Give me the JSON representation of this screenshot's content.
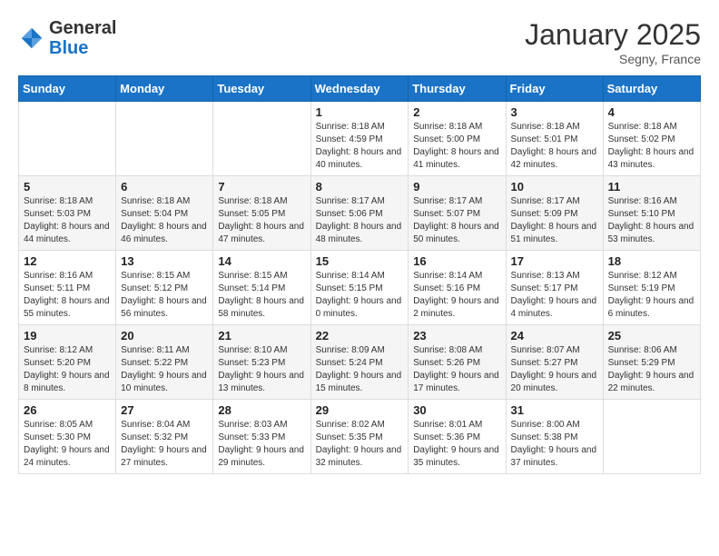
{
  "header": {
    "logo_line1": "General",
    "logo_line2": "Blue",
    "month_year": "January 2025",
    "location": "Segny, France"
  },
  "weekdays": [
    "Sunday",
    "Monday",
    "Tuesday",
    "Wednesday",
    "Thursday",
    "Friday",
    "Saturday"
  ],
  "weeks": [
    [
      {
        "day": "",
        "sunrise": "",
        "sunset": "",
        "daylight": ""
      },
      {
        "day": "",
        "sunrise": "",
        "sunset": "",
        "daylight": ""
      },
      {
        "day": "",
        "sunrise": "",
        "sunset": "",
        "daylight": ""
      },
      {
        "day": "1",
        "sunrise": "Sunrise: 8:18 AM",
        "sunset": "Sunset: 4:59 PM",
        "daylight": "Daylight: 8 hours and 40 minutes."
      },
      {
        "day": "2",
        "sunrise": "Sunrise: 8:18 AM",
        "sunset": "Sunset: 5:00 PM",
        "daylight": "Daylight: 8 hours and 41 minutes."
      },
      {
        "day": "3",
        "sunrise": "Sunrise: 8:18 AM",
        "sunset": "Sunset: 5:01 PM",
        "daylight": "Daylight: 8 hours and 42 minutes."
      },
      {
        "day": "4",
        "sunrise": "Sunrise: 8:18 AM",
        "sunset": "Sunset: 5:02 PM",
        "daylight": "Daylight: 8 hours and 43 minutes."
      }
    ],
    [
      {
        "day": "5",
        "sunrise": "Sunrise: 8:18 AM",
        "sunset": "Sunset: 5:03 PM",
        "daylight": "Daylight: 8 hours and 44 minutes."
      },
      {
        "day": "6",
        "sunrise": "Sunrise: 8:18 AM",
        "sunset": "Sunset: 5:04 PM",
        "daylight": "Daylight: 8 hours and 46 minutes."
      },
      {
        "day": "7",
        "sunrise": "Sunrise: 8:18 AM",
        "sunset": "Sunset: 5:05 PM",
        "daylight": "Daylight: 8 hours and 47 minutes."
      },
      {
        "day": "8",
        "sunrise": "Sunrise: 8:17 AM",
        "sunset": "Sunset: 5:06 PM",
        "daylight": "Daylight: 8 hours and 48 minutes."
      },
      {
        "day": "9",
        "sunrise": "Sunrise: 8:17 AM",
        "sunset": "Sunset: 5:07 PM",
        "daylight": "Daylight: 8 hours and 50 minutes."
      },
      {
        "day": "10",
        "sunrise": "Sunrise: 8:17 AM",
        "sunset": "Sunset: 5:09 PM",
        "daylight": "Daylight: 8 hours and 51 minutes."
      },
      {
        "day": "11",
        "sunrise": "Sunrise: 8:16 AM",
        "sunset": "Sunset: 5:10 PM",
        "daylight": "Daylight: 8 hours and 53 minutes."
      }
    ],
    [
      {
        "day": "12",
        "sunrise": "Sunrise: 8:16 AM",
        "sunset": "Sunset: 5:11 PM",
        "daylight": "Daylight: 8 hours and 55 minutes."
      },
      {
        "day": "13",
        "sunrise": "Sunrise: 8:15 AM",
        "sunset": "Sunset: 5:12 PM",
        "daylight": "Daylight: 8 hours and 56 minutes."
      },
      {
        "day": "14",
        "sunrise": "Sunrise: 8:15 AM",
        "sunset": "Sunset: 5:14 PM",
        "daylight": "Daylight: 8 hours and 58 minutes."
      },
      {
        "day": "15",
        "sunrise": "Sunrise: 8:14 AM",
        "sunset": "Sunset: 5:15 PM",
        "daylight": "Daylight: 9 hours and 0 minutes."
      },
      {
        "day": "16",
        "sunrise": "Sunrise: 8:14 AM",
        "sunset": "Sunset: 5:16 PM",
        "daylight": "Daylight: 9 hours and 2 minutes."
      },
      {
        "day": "17",
        "sunrise": "Sunrise: 8:13 AM",
        "sunset": "Sunset: 5:17 PM",
        "daylight": "Daylight: 9 hours and 4 minutes."
      },
      {
        "day": "18",
        "sunrise": "Sunrise: 8:12 AM",
        "sunset": "Sunset: 5:19 PM",
        "daylight": "Daylight: 9 hours and 6 minutes."
      }
    ],
    [
      {
        "day": "19",
        "sunrise": "Sunrise: 8:12 AM",
        "sunset": "Sunset: 5:20 PM",
        "daylight": "Daylight: 9 hours and 8 minutes."
      },
      {
        "day": "20",
        "sunrise": "Sunrise: 8:11 AM",
        "sunset": "Sunset: 5:22 PM",
        "daylight": "Daylight: 9 hours and 10 minutes."
      },
      {
        "day": "21",
        "sunrise": "Sunrise: 8:10 AM",
        "sunset": "Sunset: 5:23 PM",
        "daylight": "Daylight: 9 hours and 13 minutes."
      },
      {
        "day": "22",
        "sunrise": "Sunrise: 8:09 AM",
        "sunset": "Sunset: 5:24 PM",
        "daylight": "Daylight: 9 hours and 15 minutes."
      },
      {
        "day": "23",
        "sunrise": "Sunrise: 8:08 AM",
        "sunset": "Sunset: 5:26 PM",
        "daylight": "Daylight: 9 hours and 17 minutes."
      },
      {
        "day": "24",
        "sunrise": "Sunrise: 8:07 AM",
        "sunset": "Sunset: 5:27 PM",
        "daylight": "Daylight: 9 hours and 20 minutes."
      },
      {
        "day": "25",
        "sunrise": "Sunrise: 8:06 AM",
        "sunset": "Sunset: 5:29 PM",
        "daylight": "Daylight: 9 hours and 22 minutes."
      }
    ],
    [
      {
        "day": "26",
        "sunrise": "Sunrise: 8:05 AM",
        "sunset": "Sunset: 5:30 PM",
        "daylight": "Daylight: 9 hours and 24 minutes."
      },
      {
        "day": "27",
        "sunrise": "Sunrise: 8:04 AM",
        "sunset": "Sunset: 5:32 PM",
        "daylight": "Daylight: 9 hours and 27 minutes."
      },
      {
        "day": "28",
        "sunrise": "Sunrise: 8:03 AM",
        "sunset": "Sunset: 5:33 PM",
        "daylight": "Daylight: 9 hours and 29 minutes."
      },
      {
        "day": "29",
        "sunrise": "Sunrise: 8:02 AM",
        "sunset": "Sunset: 5:35 PM",
        "daylight": "Daylight: 9 hours and 32 minutes."
      },
      {
        "day": "30",
        "sunrise": "Sunrise: 8:01 AM",
        "sunset": "Sunset: 5:36 PM",
        "daylight": "Daylight: 9 hours and 35 minutes."
      },
      {
        "day": "31",
        "sunrise": "Sunrise: 8:00 AM",
        "sunset": "Sunset: 5:38 PM",
        "daylight": "Daylight: 9 hours and 37 minutes."
      },
      {
        "day": "",
        "sunrise": "",
        "sunset": "",
        "daylight": ""
      }
    ]
  ]
}
